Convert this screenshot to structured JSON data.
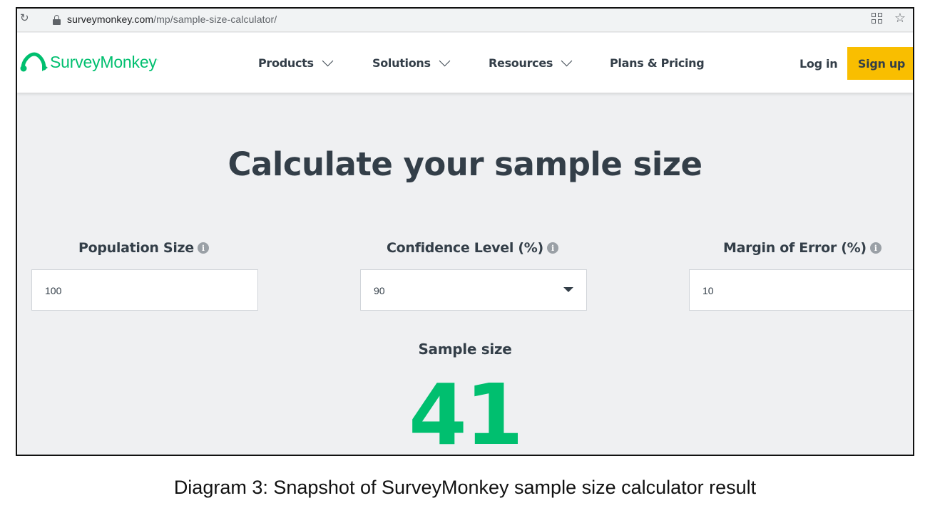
{
  "browser": {
    "url_domain": "surveymonkey.com",
    "url_path": "/mp/sample-size-calculator/",
    "icons": [
      "reload-icon",
      "lock-icon",
      "qr-code-icon",
      "bookmark-star-icon"
    ]
  },
  "header": {
    "logo_text": "SurveyMonkey",
    "nav": [
      {
        "label": "Products",
        "has_dropdown": true
      },
      {
        "label": "Solutions",
        "has_dropdown": true
      },
      {
        "label": "Resources",
        "has_dropdown": true
      },
      {
        "label": "Plans & Pricing",
        "has_dropdown": false
      }
    ],
    "login_label": "Log in",
    "signup_label": "Sign up"
  },
  "calculator": {
    "title": "Calculate your sample size",
    "fields": [
      {
        "label": "Population Size",
        "value": "100"
      },
      {
        "label": "Confidence Level (%)",
        "value": "90"
      },
      {
        "label": "Margin of Error (%)",
        "value": "10"
      }
    ],
    "result_label": "Sample size",
    "result_value": "41"
  },
  "caption": "Diagram 3: Snapshot of SurveyMonkey sample size calculator result",
  "colors": {
    "brand_green": "#00bf6f",
    "signup_yellow": "#f9be00",
    "text_dark": "#333e48"
  }
}
